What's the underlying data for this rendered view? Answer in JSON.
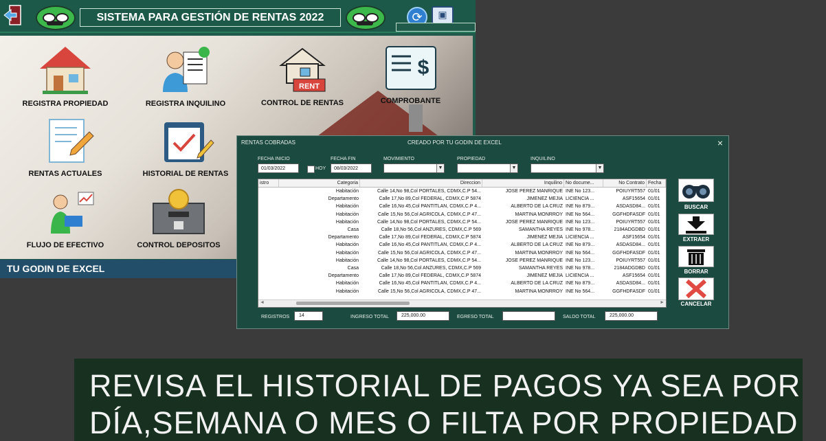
{
  "app": {
    "title": "SISTEMA PARA GESTIÓN DE RENTAS 2022",
    "footer": "TU GODIN DE EXCEL",
    "menu": [
      {
        "label": "REGISTRA PROPIEDAD",
        "icon": "house-icon"
      },
      {
        "label": "REGISTRA INQUILINO",
        "icon": "tenant-icon"
      },
      {
        "label": "CONTROL DE RENTAS",
        "icon": "rent-house-icon"
      },
      {
        "label": "COMPROBANTE",
        "icon": "receipt-icon"
      },
      {
        "label": "RENTAS ACTUALES",
        "icon": "document-pen-icon"
      },
      {
        "label": "HISTORIAL DE RENTAS",
        "icon": "clipboard-check-icon"
      },
      {
        "label": "FLUJO DE EFECTIVO",
        "icon": "cashflow-icon"
      },
      {
        "label": "CONTROL DEPOSITOS",
        "icon": "deposit-box-icon"
      }
    ]
  },
  "dialog": {
    "title": "RENTAS COBRADAS",
    "credit": "CREADO POR  TU GODIN DE EXCEL",
    "close": "×",
    "filters": {
      "fecha_inicio_label": "FECHA INICIO",
      "fecha_inicio": "01/03/2022",
      "hoy_label": "HOY",
      "fecha_fin_label": "FECHA FIN",
      "fecha_fin": "08/03/2022",
      "movimiento_label": "MOVIMIENTO",
      "propiedad_label": "PROPIEDAD",
      "inquilino_label": "INQUILINO"
    },
    "columns": [
      "istro",
      "Categoria",
      "Direccion",
      "Inquilino",
      "No docume...",
      "No Contrato",
      "Fecha"
    ],
    "rows": [
      [
        "",
        "Habitación",
        "Calle 14,No 98,Col PORTALES, CDMX,C.P 54...",
        "JOSE PEREZ MANRIQUE",
        "INE No 123...",
        "POIUYRT557",
        "01/01"
      ],
      [
        "",
        "Departamento",
        "Calle 17,No 89,Col FEDERAL, CDMX,C.P 5874",
        "JIMENEZ MEJIA",
        "LICIENCIA ...",
        "ASF15654",
        "01/01"
      ],
      [
        "",
        "Habitación",
        "Calle 16,No 45,Col PANTITLAN, CDMX,C.P 4...",
        "ALBERTO DE LA CRUZ",
        "INE No 879...",
        "ASDASD84...",
        "01/01"
      ],
      [
        "",
        "Habitación",
        "Calle 15,No 56,Col AGRICOLA, CDMX,C.P 47...",
        "MARTINA MONRROY",
        "INE No 564...",
        "GGFHDFASDF",
        "01/01"
      ],
      [
        "",
        "Habitación",
        "Calle 14,No 98,Col PORTALES, CDMX,C.P 54...",
        "JOSE PEREZ MANRIQUE",
        "INE No 123...",
        "POIUYRT557",
        "01/01"
      ],
      [
        "",
        "Casa",
        "Calle 18,No 56,Col ANZURES, CDMX,C.P 569",
        "SAMANTHA REYES",
        "INE No 978...",
        "2184ADGDBD",
        "01/01"
      ],
      [
        "",
        "Departamento",
        "Calle 17,No 89,Col FEDERAL, CDMX,C.P 5874",
        "JIMENEZ MEJIA",
        "LICIENCIA ...",
        "ASF15654",
        "01/01"
      ],
      [
        "",
        "Habitación",
        "Calle 16,No 45,Col PANTITLAN, CDMX,C.P 4...",
        "ALBERTO DE LA CRUZ",
        "INE No 879...",
        "ASDASD84...",
        "01/01"
      ],
      [
        "",
        "Habitación",
        "Calle 15,No 56,Col AGRICOLA, CDMX,C.P 47...",
        "MARTINA MONRROY",
        "INE No 564...",
        "GGFHDFASDF",
        "01/01"
      ],
      [
        "",
        "Habitación",
        "Calle 14,No 98,Col PORTALES, CDMX,C.P 54...",
        "JOSE PEREZ MANRIQUE",
        "INE No 123...",
        "POIUYRT557",
        "01/01"
      ],
      [
        "",
        "Casa",
        "Calle 18,No 56,Col ANZURES, CDMX,C.P 569",
        "SAMANTHA REYES",
        "INE No 978...",
        "2184ADGDBD",
        "01/01"
      ],
      [
        "",
        "Departamento",
        "Calle 17,No 89,Col FEDERAL, CDMX,C.P 5874",
        "JIMENEZ MEJIA",
        "LICIENCIA ...",
        "ASF15654",
        "01/01"
      ],
      [
        "",
        "Habitación",
        "Calle 16,No 45,Col PANTITLAN, CDMX,C.P 4...",
        "ALBERTO DE LA CRUZ",
        "INE No 879...",
        "ASDASD84...",
        "01/01"
      ],
      [
        "",
        "Habitación",
        "Calle 15,No 56,Col AGRICOLA, CDMX,C.P 47...",
        "MARTINA MONRROY",
        "INE No 564...",
        "GGFHDFASDF",
        "01/01"
      ]
    ],
    "actions": {
      "buscar": "BUSCAR",
      "extraer": "EXTRAER",
      "borrar": "BORRAR",
      "cancelar": "CANCELAR"
    },
    "summary": {
      "registros_label": "REGISTROS",
      "registros": "14",
      "ingreso_label": "INGRESO TOTAL",
      "ingreso": "225,000.00",
      "egreso_label": "EGRESO TOTAL",
      "egreso": "",
      "saldo_label": "SALDO TOTAL",
      "saldo": "225,000.00"
    }
  },
  "caption": {
    "line1": "REVISA EL HISTORIAL DE PAGOS YA SEA POR",
    "line2": "DÍA,SEMANA O MES O FILTA POR PROPIEDAD"
  }
}
